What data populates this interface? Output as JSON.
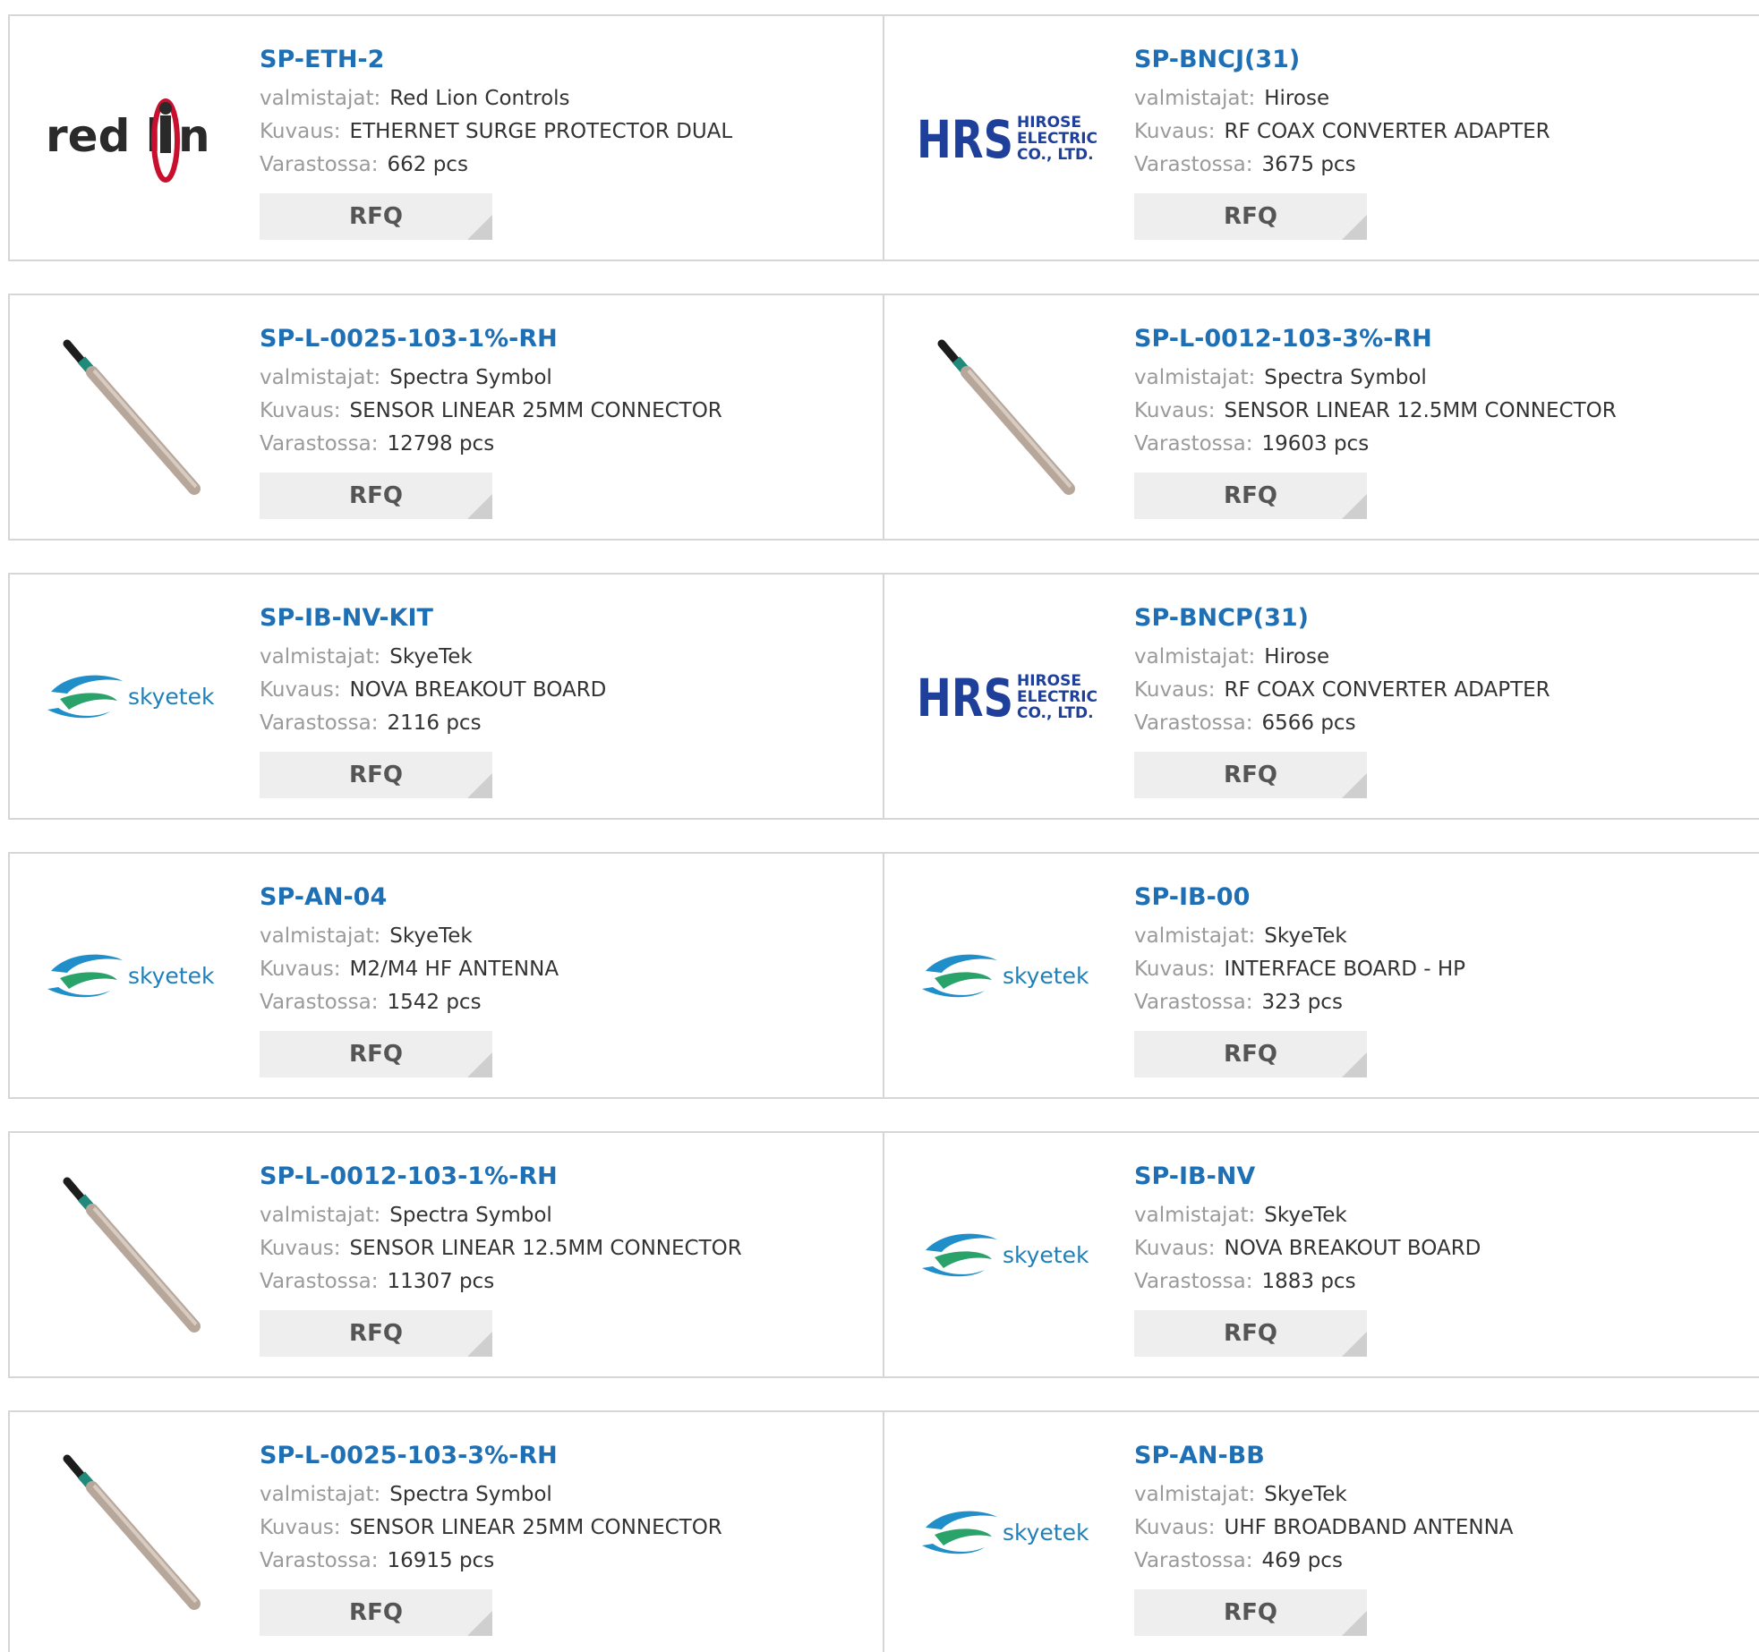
{
  "labels": {
    "manufacturer": "valmistajat:",
    "description": "Kuvaus:",
    "stock": "Varastossa:",
    "rfq": "RFQ"
  },
  "brands": {
    "redlion_a": "red l",
    "redlion_b": "n",
    "hrs_main": "HRS",
    "hrs_l1": "HIROSE",
    "hrs_l2": "ELECTRIC",
    "hrs_l3": "CO., LTD.",
    "skyetek": "skyetek"
  },
  "colors": {
    "part_link": "#1f6fb5",
    "label": "#9a9a9a",
    "value": "#333333",
    "rfq_bg": "#eeeeee"
  },
  "products": [
    {
      "part": "SP-ETH-2",
      "manufacturer": "Red Lion Controls",
      "description": "ETHERNET SURGE PROTECTOR DUAL",
      "stock": "662 pcs",
      "logo": "redlion"
    },
    {
      "part": "SP-BNCJ(31)",
      "manufacturer": "Hirose",
      "description": "RF COAX CONVERTER ADAPTER",
      "stock": "3675 pcs",
      "logo": "hirose"
    },
    {
      "part": "SP-L-0025-103-1%-RH",
      "manufacturer": "Spectra Symbol",
      "description": "SENSOR LINEAR 25MM CONNECTOR",
      "stock": "12798 pcs",
      "logo": "sensor"
    },
    {
      "part": "SP-L-0012-103-3%-RH",
      "manufacturer": "Spectra Symbol",
      "description": "SENSOR LINEAR 12.5MM CONNECTOR",
      "stock": "19603 pcs",
      "logo": "sensor"
    },
    {
      "part": "SP-IB-NV-KIT",
      "manufacturer": "SkyeTek",
      "description": "NOVA BREAKOUT BOARD",
      "stock": "2116 pcs",
      "logo": "skyetek"
    },
    {
      "part": "SP-BNCP(31)",
      "manufacturer": "Hirose",
      "description": "RF COAX CONVERTER ADAPTER",
      "stock": "6566 pcs",
      "logo": "hirose"
    },
    {
      "part": "SP-AN-04",
      "manufacturer": "SkyeTek",
      "description": "M2/M4 HF ANTENNA",
      "stock": "1542 pcs",
      "logo": "skyetek"
    },
    {
      "part": "SP-IB-00",
      "manufacturer": "SkyeTek",
      "description": "INTERFACE BOARD - HP",
      "stock": "323 pcs",
      "logo": "skyetek"
    },
    {
      "part": "SP-L-0012-103-1%-RH",
      "manufacturer": "Spectra Symbol",
      "description": "SENSOR LINEAR 12.5MM CONNECTOR",
      "stock": "11307 pcs",
      "logo": "sensor"
    },
    {
      "part": "SP-IB-NV",
      "manufacturer": "SkyeTek",
      "description": "NOVA BREAKOUT BOARD",
      "stock": "1883 pcs",
      "logo": "skyetek"
    },
    {
      "part": "SP-L-0025-103-3%-RH",
      "manufacturer": "Spectra Symbol",
      "description": "SENSOR LINEAR 25MM CONNECTOR",
      "stock": "16915 pcs",
      "logo": "sensor"
    },
    {
      "part": "SP-AN-BB",
      "manufacturer": "SkyeTek",
      "description": "UHF BROADBAND ANTENNA",
      "stock": "469 pcs",
      "logo": "skyetek"
    }
  ]
}
